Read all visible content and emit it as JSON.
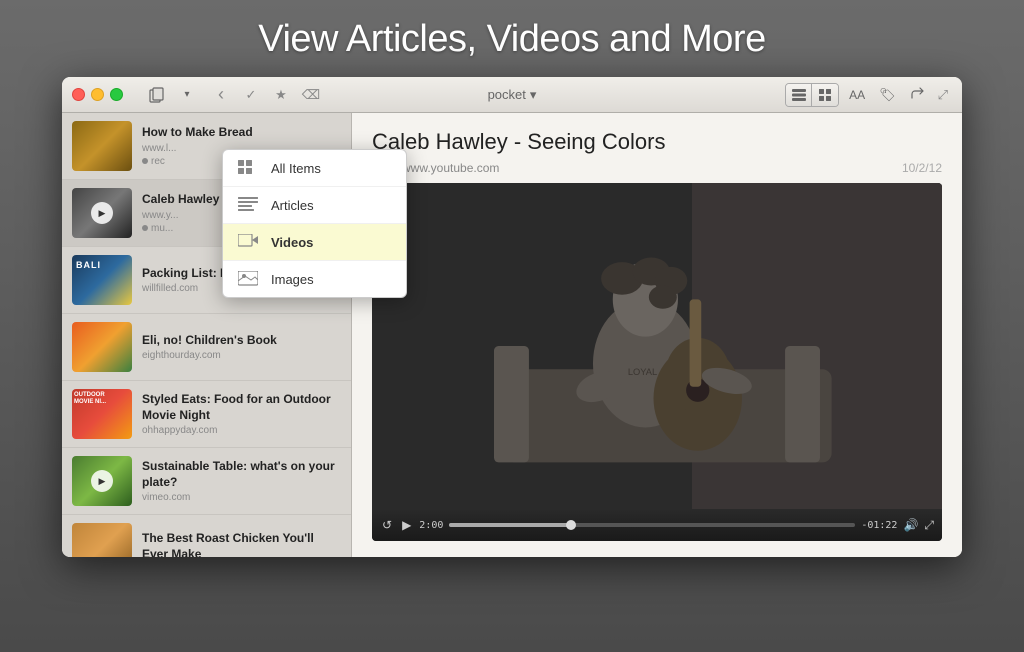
{
  "page": {
    "title": "View Articles, Videos and More"
  },
  "titlebar": {
    "app_name": "pocket",
    "dropdown_arrow": "▾"
  },
  "toolbar": {
    "back": "‹",
    "check": "✓",
    "star": "★",
    "trash": "🗑",
    "font": "AA",
    "tag": "🏷",
    "share": "↗",
    "resize": "⤢"
  },
  "dropdown": {
    "items": [
      {
        "id": "all-items",
        "label": "All Items",
        "active": false
      },
      {
        "id": "articles",
        "label": "Articles",
        "active": false
      },
      {
        "id": "videos",
        "label": "Videos",
        "active": true
      },
      {
        "id": "images",
        "label": "Images",
        "active": false
      }
    ]
  },
  "sidebar": {
    "items": [
      {
        "id": "item-bread",
        "title": "How to Make Bread",
        "url": "www.l...",
        "tag": "rec",
        "thumb_type": "bread",
        "has_play": false
      },
      {
        "id": "item-caleb",
        "title": "Caleb Hawley - Seeing Colors",
        "url": "www.y...",
        "tag": "mu...",
        "thumb_type": "caleb",
        "has_play": true
      },
      {
        "id": "item-bali",
        "title": "Packing List: Bali",
        "url": "willfilled.com",
        "tag": "",
        "thumb_type": "bali",
        "has_play": false
      },
      {
        "id": "item-eli",
        "title": "Eli, no! Children's Book",
        "url": "eighthourday.com",
        "tag": "",
        "thumb_type": "eli",
        "has_play": false
      },
      {
        "id": "item-outdoor",
        "title": "Styled Eats: Food for an Outdoor Movie Night",
        "url": "ohhappyday.com",
        "tag": "",
        "thumb_type": "outdoor",
        "has_play": false
      },
      {
        "id": "item-table",
        "title": "Sustainable Table: what's on your plate?",
        "url": "vimeo.com",
        "tag": "",
        "thumb_type": "table",
        "has_play": true
      },
      {
        "id": "item-chicken",
        "title": "The Best Roast Chicken You'll Ever Make",
        "url": "",
        "tag": "",
        "thumb_type": "chicken",
        "has_play": false
      }
    ]
  },
  "article": {
    "title": "Caleb Hawley - Seeing Colors",
    "url": "www.youtube.com",
    "date": "10/2/12"
  },
  "video_controls": {
    "replay": "↺",
    "play": "▶",
    "time_current": "2:00",
    "time_end": "-01:22",
    "volume": "🔊",
    "fullscreen": "⤢"
  }
}
